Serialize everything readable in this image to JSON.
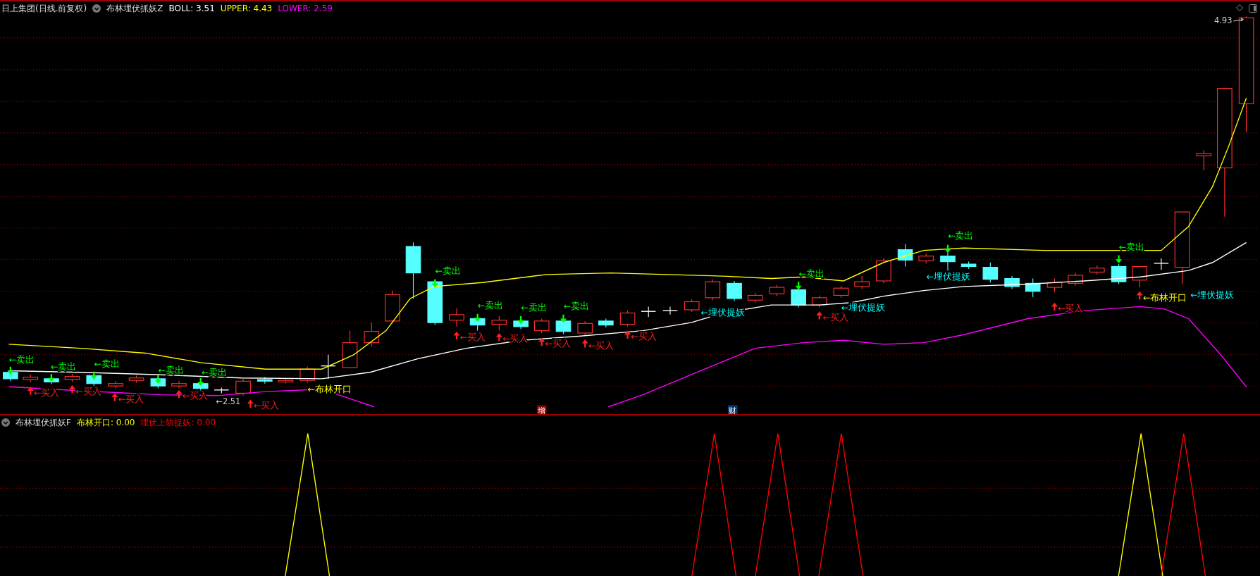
{
  "header": {
    "title": "日上集团(日线.前复权)",
    "indicator": "布林埋伏抓妖Z",
    "legend": [
      {
        "text": "BOLL: 3.51",
        "color": "#ffffff"
      },
      {
        "text": "UPPER: 4.43",
        "color": "#ffff00"
      },
      {
        "text": "LOWER: 2.59",
        "color": "#ff00ff"
      }
    ]
  },
  "main_chart": {
    "price_marks": [
      {
        "text": "4.93"
      },
      {
        "text": "←2.51"
      }
    ],
    "signals": [
      {
        "kind": "sell",
        "text": "←卖出"
      },
      {
        "kind": "sell",
        "text": "←卖出"
      },
      {
        "kind": "sell",
        "text": "←卖出"
      },
      {
        "kind": "sell",
        "text": "←卖出"
      },
      {
        "kind": "sell",
        "text": "←卖出"
      },
      {
        "kind": "sell",
        "text": "←卖出"
      },
      {
        "kind": "sell",
        "text": "←卖出"
      },
      {
        "kind": "sell",
        "text": "←卖出"
      },
      {
        "kind": "sell",
        "text": "←卖出"
      },
      {
        "kind": "sell",
        "text": "←卖出"
      },
      {
        "kind": "sell",
        "text": "←卖出"
      },
      {
        "kind": "sell",
        "text": "←卖出"
      },
      {
        "kind": "buy",
        "text": "←买入"
      },
      {
        "kind": "buy",
        "text": "←买入"
      },
      {
        "kind": "buy",
        "text": "←买入"
      },
      {
        "kind": "buy",
        "text": "←买入"
      },
      {
        "kind": "buy",
        "text": "←买入"
      },
      {
        "kind": "buy",
        "text": "←买入"
      },
      {
        "kind": "buy",
        "text": "←买入"
      },
      {
        "kind": "buy",
        "text": "←买入"
      },
      {
        "kind": "buy",
        "text": "←买入"
      },
      {
        "kind": "buy",
        "text": "←买入"
      },
      {
        "kind": "buy",
        "text": "←买入"
      },
      {
        "kind": "buy",
        "text": "←买入"
      },
      {
        "kind": "buy_mark"
      },
      {
        "kind": "ambush",
        "text": "←埋伏提妖"
      },
      {
        "kind": "ambush",
        "text": "←埋伏提妖"
      },
      {
        "kind": "ambush",
        "text": "←埋伏提妖"
      },
      {
        "kind": "ambush",
        "text": "←埋伏提妖"
      },
      {
        "kind": "open",
        "text": "←布林开口"
      },
      {
        "kind": "open",
        "text": "←布林开口"
      }
    ],
    "period_marks": [
      {
        "text": "增",
        "color": "#8b0000"
      },
      {
        "text": "财",
        "color": "#0a3a6e"
      }
    ]
  },
  "sub_header": {
    "indicator": "布林埋伏抓妖F",
    "legend": [
      {
        "text": "布林开口: 0.00",
        "color": "#ffff00"
      },
      {
        "text": "埋伏上轨捉妖: 0.00",
        "color": "#ff0000"
      }
    ]
  }
}
